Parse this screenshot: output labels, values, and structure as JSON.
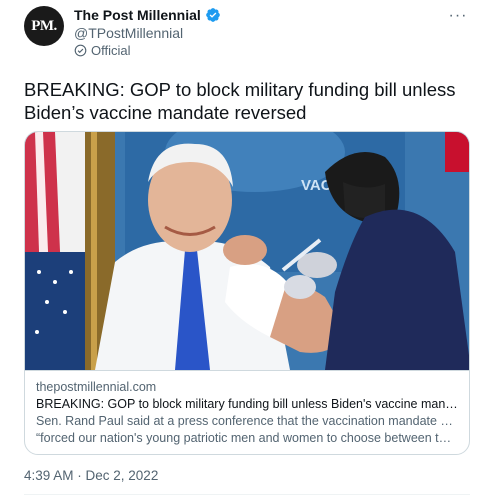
{
  "author": {
    "avatar_text": "PM.",
    "display_name": "The Post Millennial",
    "handle": "@TPostMillennial",
    "label": "Official",
    "verified_color": "#1d9bf0"
  },
  "tweet": {
    "text": "BREAKING: GOP to block military funding bill unless Biden’s vaccine mandate reversed"
  },
  "link_card": {
    "image": "vaccination-photo",
    "domain": "thepostmillennial.com",
    "title": "BREAKING: GOP to block military funding bill unless Biden's vaccine mandate r...",
    "description_line1": "Sen. Rand Paul said at a press conference that the vaccination mandate has",
    "description_line2": "“forced our nation's young patriotic men and women to choose between their ...",
    "backdrop_text": "VACC"
  },
  "meta": {
    "timestamp": "4:39 AM · Dec 2, 2022"
  },
  "icons": {
    "more": "more-options-icon",
    "verified": "verified-badge-icon",
    "official": "official-label-icon"
  }
}
